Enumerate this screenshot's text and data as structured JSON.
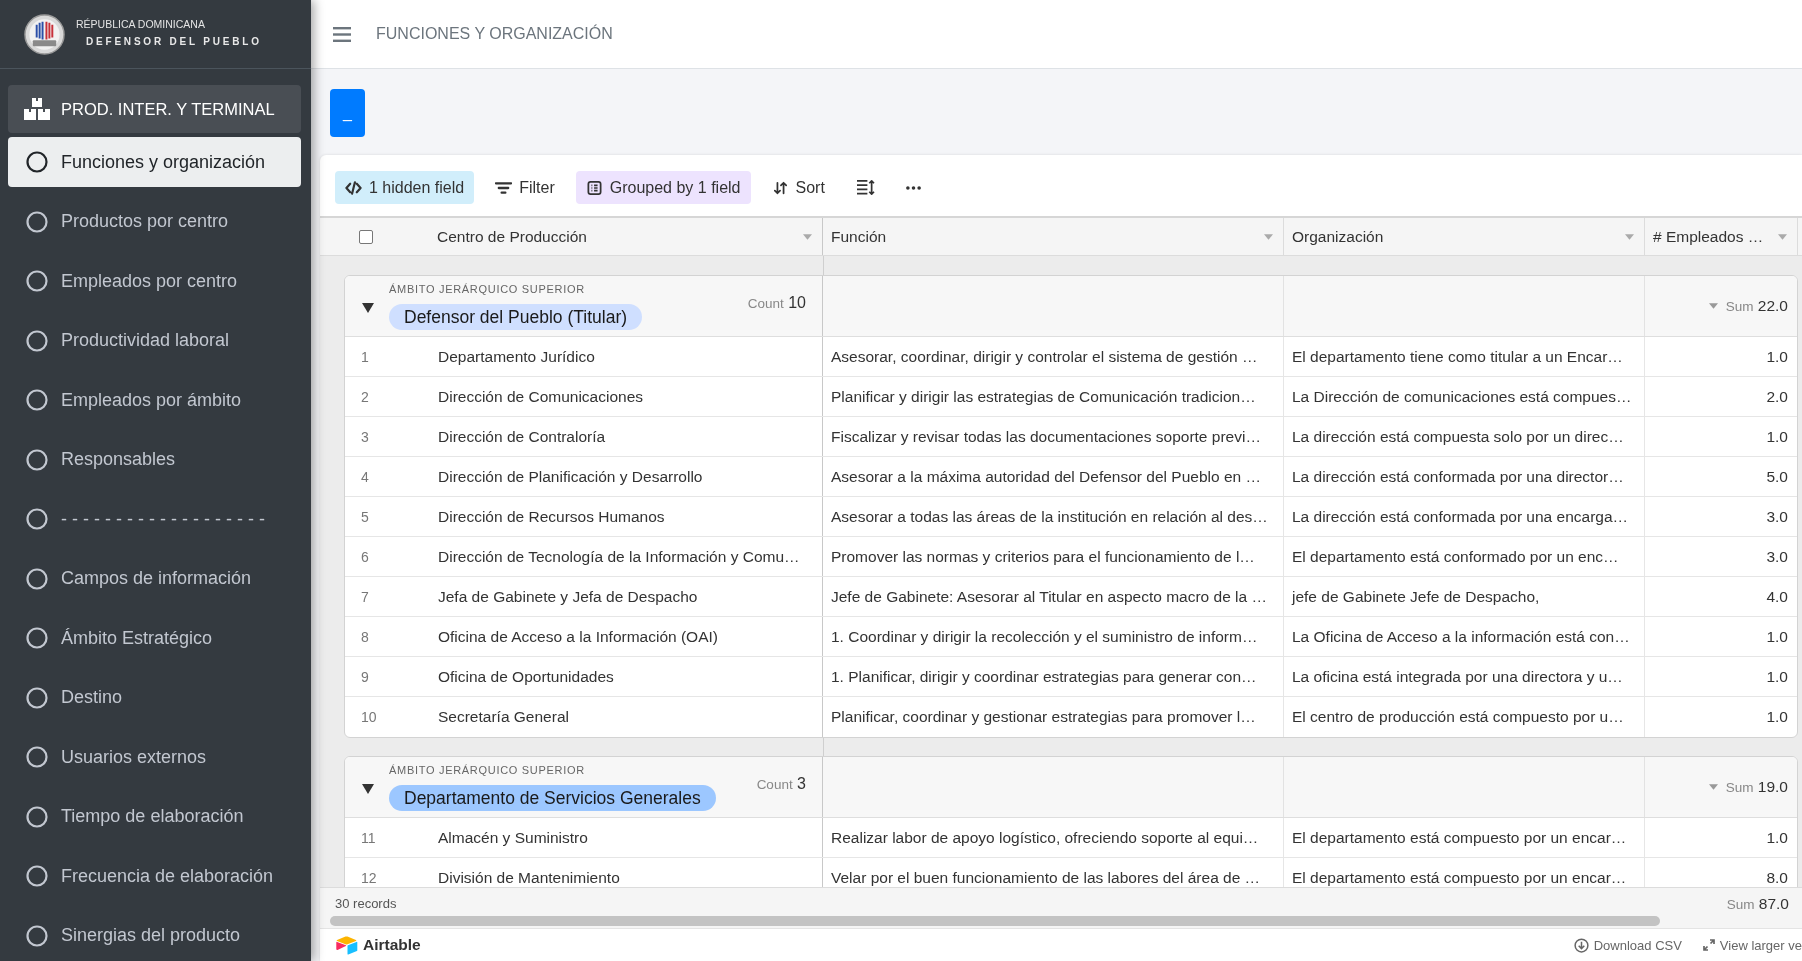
{
  "sidebar": {
    "brand": {
      "line_1": "RÉPUBLICA DOMINICANA",
      "line_2": "DEFENSOR DEL PUEBLO"
    },
    "section": {
      "label": "PROD. INTER. Y TERMINAL"
    },
    "items": [
      {
        "label": "Funciones y organización",
        "selected": true
      },
      {
        "label": "Productos por centro",
        "selected": false
      },
      {
        "label": "Empleados por centro",
        "selected": false
      },
      {
        "label": "Productividad laboral",
        "selected": false
      },
      {
        "label": "Empleados por ámbito",
        "selected": false
      },
      {
        "label": "Responsables",
        "selected": false
      },
      {
        "label": "- - - - - - - - - - - - - - - - - - -",
        "selected": false
      },
      {
        "label": "Campos de información",
        "selected": false
      },
      {
        "label": "Ámbito Estratégico",
        "selected": false
      },
      {
        "label": "Destino",
        "selected": false
      },
      {
        "label": "Usuarios externos",
        "selected": false
      },
      {
        "label": "Tiempo de elaboración",
        "selected": false
      },
      {
        "label": "Frecuencia de elaboración",
        "selected": false
      },
      {
        "label": "Sinergias del producto",
        "selected": false
      }
    ]
  },
  "header": {
    "title": "FUNCIONES Y ORGANIZACIÓN"
  },
  "action_button": {
    "label": "_"
  },
  "embed": {
    "toolbar": [
      {
        "kind": "hidden",
        "label": "1 hidden field",
        "active": true
      },
      {
        "kind": "filter",
        "label": "Filter",
        "active": false
      },
      {
        "kind": "group",
        "label": "Grouped by 1 field",
        "active": true
      },
      {
        "kind": "sort",
        "label": "Sort",
        "active": false
      },
      {
        "kind": "row_height",
        "active": false
      },
      {
        "kind": "more",
        "active": false
      }
    ],
    "select_all": {
      "checked": false
    },
    "columns": [
      {
        "label": "Centro de Producción",
        "kind": "text"
      },
      {
        "label": "Función",
        "kind": "text"
      },
      {
        "label": "Organización",
        "kind": "text"
      },
      {
        "label": "# Empleados …",
        "kind": "number"
      }
    ],
    "groups": [
      {
        "field": "ÁMBITO JERÁRQUICO SUPERIOR",
        "value": "Defensor del Pueblo (Titular)",
        "color": "#cfdfff",
        "expanded": true,
        "count_label": "Count",
        "count": "10",
        "sum_label": "Sum",
        "sum": "22.0",
        "rows": [
          {
            "number": "1",
            "cells": [
              "Departamento Jurídico",
              "Asesorar, coordinar, dirigir y controlar el sistema de gestión …",
              "El departamento tiene como titular a un Encar…",
              "1.0"
            ]
          },
          {
            "number": "2",
            "cells": [
              "Dirección de Comunicaciones",
              "Planificar y dirigir las estrategias de Comunicación tradicion…",
              "La Dirección de comunicaciones está compues…",
              "2.0"
            ]
          },
          {
            "number": "3",
            "cells": [
              "Dirección de Contraloría",
              "Fiscalizar y revisar todas las documentaciones soporte previ…",
              "La dirección está compuesta solo por un direc…",
              "1.0"
            ]
          },
          {
            "number": "4",
            "cells": [
              "Dirección de Planificación y Desarrollo",
              "Asesorar a la máxima autoridad del Defensor del Pueblo en …",
              "La dirección está conformada por una director…",
              "5.0"
            ]
          },
          {
            "number": "5",
            "cells": [
              "Dirección de Recursos Humanos",
              "Asesorar a todas las áreas de la institución en relación al des…",
              "La dirección está conformada por una encarga…",
              "3.0"
            ]
          },
          {
            "number": "6",
            "cells": [
              "Dirección de Tecnología de la Información y Comu…",
              "Promover las normas y criterios para el funcionamiento de l…",
              "El departamento está conformado por un enc…",
              "3.0"
            ]
          },
          {
            "number": "7",
            "cells": [
              "Jefa de Gabinete y Jefa de Despacho",
              "Jefe de Gabinete: Asesorar al Titular en aspecto macro de la …",
              "jefe de Gabinete Jefe de Despacho,",
              "4.0"
            ]
          },
          {
            "number": "8",
            "cells": [
              "Oficina de Acceso a la Información (OAI)",
              "1. Coordinar y dirigir la recolección y el suministro de inform…",
              "La Oficina de Acceso a la información está con…",
              "1.0"
            ]
          },
          {
            "number": "9",
            "cells": [
              "Oficina de Oportunidades",
              "1. Planificar, dirigir y coordinar estrategias para generar con…",
              "La oficina está integrada por una directora y u…",
              "1.0"
            ]
          },
          {
            "number": "10",
            "cells": [
              "Secretaría General",
              "Planificar, coordinar y gestionar estrategias para promover l…",
              "El centro de producción está compuesto por u…",
              "1.0"
            ]
          }
        ]
      },
      {
        "field": "ÁMBITO JERÁRQUICO SUPERIOR",
        "value": "Departamento de Servicios Generales",
        "color": "#9cc7ff",
        "expanded": true,
        "count_label": "Count",
        "count": "3",
        "sum_label": "Sum",
        "sum": "19.0",
        "rows": [
          {
            "number": "11",
            "cells": [
              "Almacén y Suministro",
              "Realizar labor de apoyo logístico, ofreciendo soporte al equi…",
              "El departamento está compuesto por un encar…",
              "1.0"
            ]
          },
          {
            "number": "12",
            "cells": [
              "División de Mantenimiento",
              "Velar por el buen funcionamiento de las labores del área de …",
              "El departamento está compuesto por un encar…",
              "8.0"
            ]
          }
        ]
      }
    ],
    "footer": {
      "records": "30 records",
      "sum_label": "Sum",
      "sum": "87.0"
    },
    "brand": "Airtable",
    "links": [
      {
        "kind": "download",
        "label": "Download CSV"
      },
      {
        "kind": "expand",
        "label": "View larger ve"
      }
    ]
  }
}
